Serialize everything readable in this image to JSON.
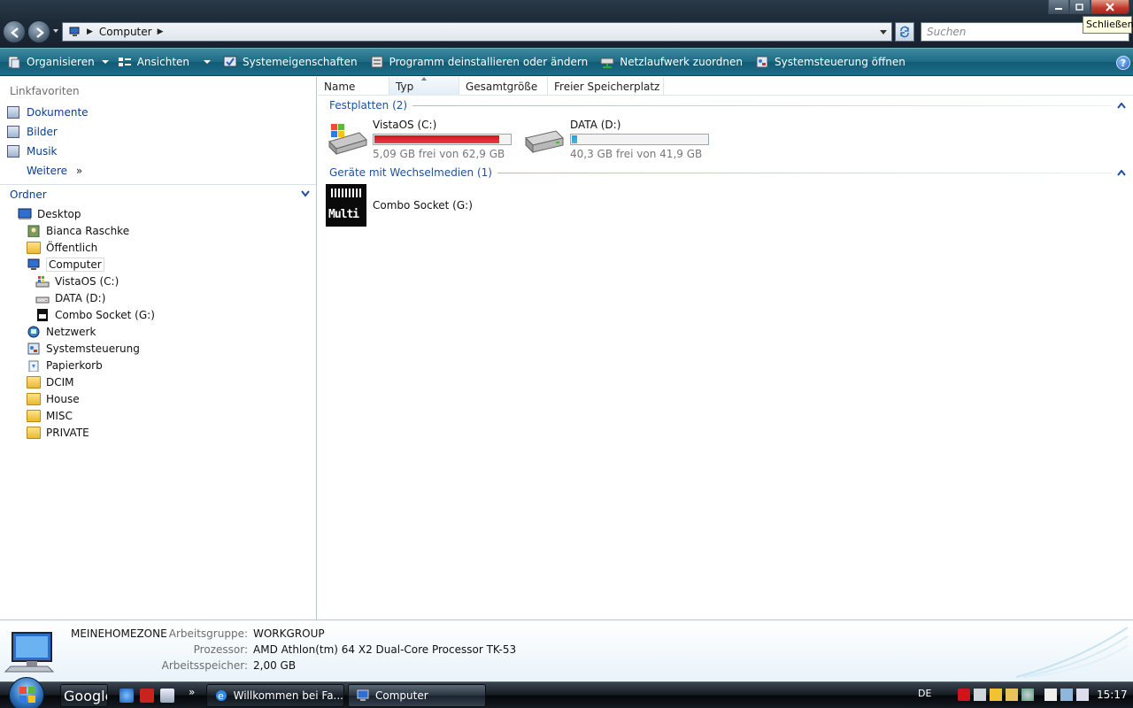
{
  "window": {
    "address": {
      "crumb": "Computer"
    },
    "search_placeholder": "Suchen",
    "tooltip": "Schließen"
  },
  "toolbar": {
    "organize": "Organisieren",
    "views": "Ansichten",
    "system_properties": "Systemeigenschaften",
    "uninstall": "Programm deinstallieren oder ändern",
    "map_drive": "Netzlaufwerk zuordnen",
    "control_panel": "Systemsteuerung öffnen",
    "help": "?"
  },
  "nav": {
    "favorites_header": "Linkfavoriten",
    "favorites": [
      "Dokumente",
      "Bilder",
      "Musik"
    ],
    "more": "Weitere",
    "folders_header": "Ordner",
    "tree": [
      {
        "label": "Desktop",
        "level": 0,
        "icon": "desktop-icon"
      },
      {
        "label": "Bianca Raschke",
        "level": 1,
        "icon": "user-folder-icon"
      },
      {
        "label": "Öffentlich",
        "level": 1,
        "icon": "folder-icon"
      },
      {
        "label": "Computer",
        "level": 1,
        "icon": "computer-icon"
      },
      {
        "label": "VistaOS (C:)",
        "level": 2,
        "icon": "windows-drive-icon"
      },
      {
        "label": "DATA (D:)",
        "level": 2,
        "icon": "hard-drive-icon"
      },
      {
        "label": "Combo Socket (G:)",
        "level": 2,
        "icon": "memory-card-icon"
      },
      {
        "label": "Netzwerk",
        "level": 1,
        "icon": "network-icon"
      },
      {
        "label": "Systemsteuerung",
        "level": 1,
        "icon": "control-panel-icon"
      },
      {
        "label": "Papierkorb",
        "level": 1,
        "icon": "recycle-bin-icon"
      },
      {
        "label": "DCIM",
        "level": 1,
        "icon": "folder-icon"
      },
      {
        "label": "House",
        "level": 1,
        "icon": "folder-icon"
      },
      {
        "label": "MISC",
        "level": 1,
        "icon": "folder-icon"
      },
      {
        "label": "PRIVATE",
        "level": 1,
        "icon": "folder-icon"
      }
    ]
  },
  "columns": [
    "Name",
    "Typ",
    "Gesamtgröße",
    "Freier Speicherplatz"
  ],
  "groups": {
    "hard_disks": "Festplatten (2)",
    "removable": "Geräte mit Wechselmedien (1)"
  },
  "drives": [
    {
      "name": "VistaOS (C:)",
      "free": "5,09 GB frei von 62,9 GB",
      "used_fraction": 0.92,
      "bar_color": "#d8121e"
    },
    {
      "name": "DATA (D:)",
      "free": "40,3 GB frei von 41,9 GB",
      "used_fraction": 0.04,
      "bar_color": "#26a0da"
    }
  ],
  "removable": [
    {
      "name": "Combo Socket (G:)",
      "icon_text": "Multi"
    }
  ],
  "details": {
    "computer_name": "MEINEHOMEZONE",
    "workgroup_label": "Arbeitsgruppe:",
    "workgroup": "WORKGROUP",
    "processor_label": "Prozessor:",
    "processor": "AMD Athlon(tm) 64 X2 Dual-Core Processor TK-53",
    "memory_label": "Arbeitsspeicher:",
    "memory": "2,00 GB"
  },
  "taskbar": {
    "google": "Google",
    "quicklaunch_more": "»",
    "items": [
      "Willkommen bei Fa...",
      "Computer"
    ],
    "language": "DE",
    "clock": "15:17"
  }
}
